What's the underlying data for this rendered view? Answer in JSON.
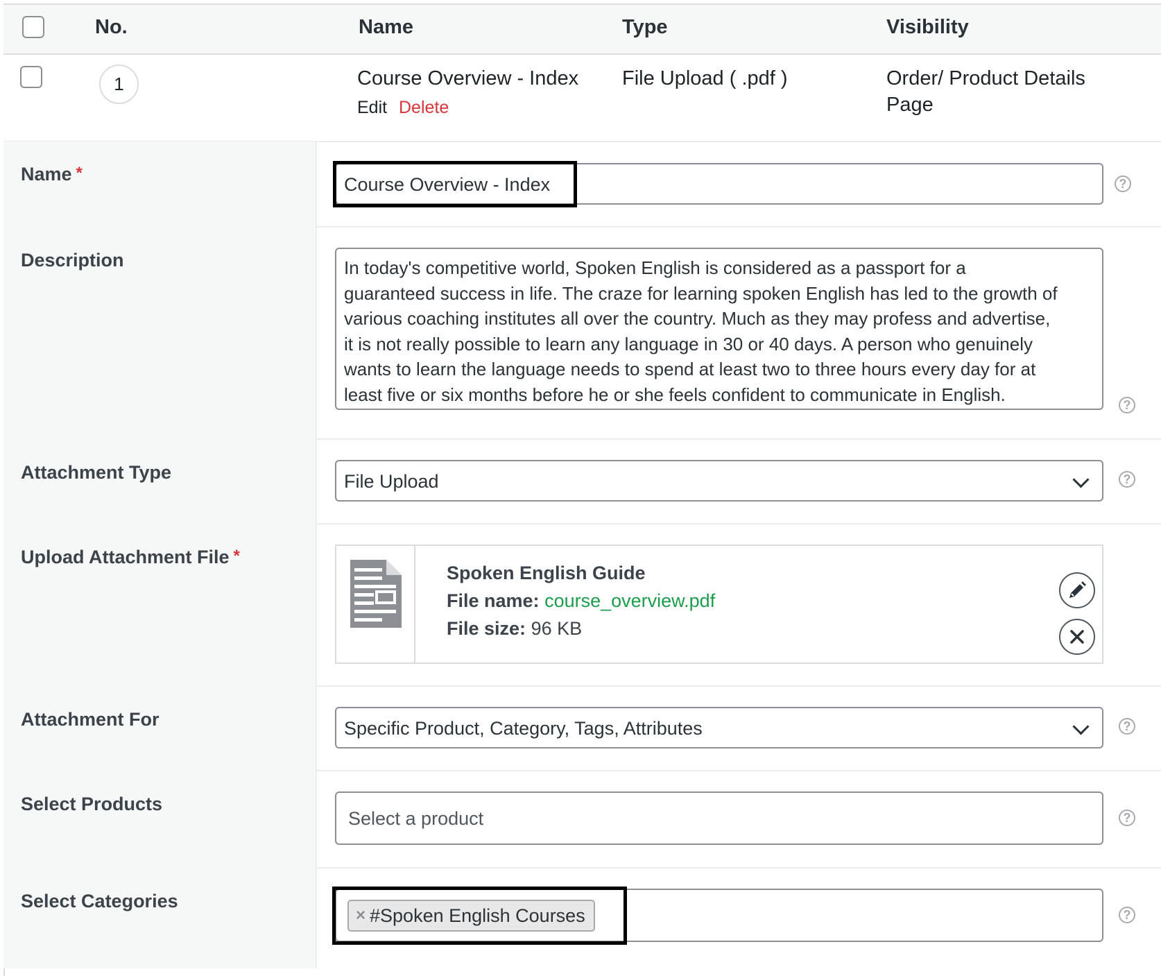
{
  "table": {
    "headers": {
      "no": "No.",
      "name": "Name",
      "type": "Type",
      "visibility": "Visibility"
    },
    "rows": [
      {
        "number": "1",
        "name": "Course Overview - Index",
        "edit": "Edit",
        "delete": "Delete",
        "type": "File Upload ( .pdf )",
        "visibility_line1": "Order/ Product Details",
        "visibility_line2": "Page"
      }
    ]
  },
  "form": {
    "name": {
      "label": "Name",
      "required": "*",
      "value": "Course Overview - Index"
    },
    "description": {
      "label": "Description",
      "lines": [
        "In today's competitive world, Spoken English is considered as a passport for a",
        "guaranteed success in life. The craze for learning spoken English has led to the growth of",
        "various coaching institutes all over the country. Much as they may profess and advertise,",
        "it is not really possible to learn any language in 30 or 40 days. A person who genuinely",
        "wants to learn the language needs to spend at least two to three hours every day for at",
        "least five or six months before he or she feels confident to communicate in English."
      ]
    },
    "attachment_type": {
      "label": "Attachment Type",
      "value": "File Upload"
    },
    "upload": {
      "label": "Upload Attachment File",
      "required": "*",
      "title": "Spoken English Guide",
      "file_name_label": "File name:",
      "file_name": "course_overview.pdf",
      "file_size_label": "File size:",
      "file_size": "96 KB",
      "icon": "document-icon"
    },
    "attachment_for": {
      "label": "Attachment For",
      "value": "Specific Product, Category, Tags, Attributes"
    },
    "select_products": {
      "label": "Select Products",
      "placeholder": "Select a product"
    },
    "select_categories": {
      "label": "Select Categories",
      "remove": "×",
      "tag": "#Spoken English Courses"
    },
    "help_symbol": "?"
  },
  "colors": {
    "delete": "#d63638",
    "link_green": "#1a9e4b",
    "required": "#d63638",
    "highlight": "#000000"
  }
}
